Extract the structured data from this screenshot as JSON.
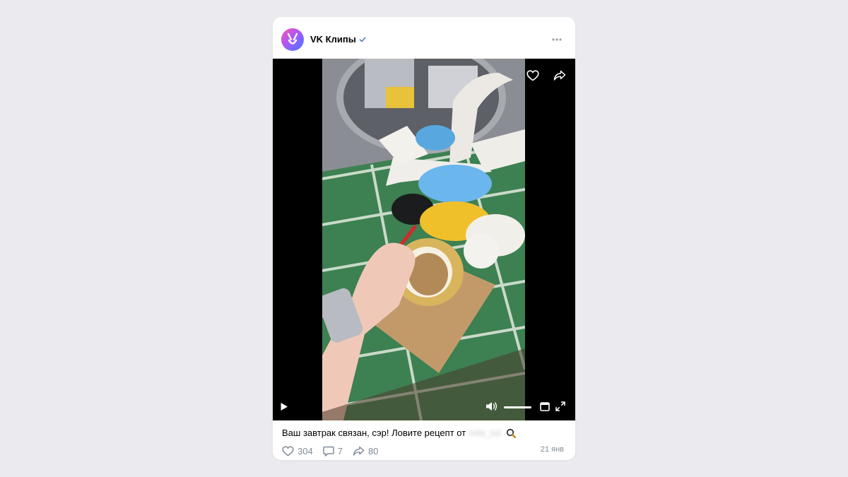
{
  "post": {
    "author": "VK Клипы",
    "caption": "Ваш завтрак связан, сэр! Ловите рецепт от",
    "caption_hidden_handle": "mila_tut",
    "likes": "304",
    "comments": "7",
    "shares": "80",
    "date": "21 янв"
  },
  "icons": {
    "avatar": "vk-clips-logo",
    "verified": "verified-check-icon",
    "more": "more-horizontal-icon",
    "like": "heart-icon",
    "share": "share-arrow-icon",
    "play": "play-icon",
    "volume": "speaker-icon",
    "miniplayer": "miniplayer-icon",
    "fullscreen": "fullscreen-icon",
    "comment": "comment-icon",
    "magnifier": "magnifier-emoji"
  },
  "colors": {
    "background": "#ebebef",
    "card": "#ffffff",
    "accent": "#2a5885",
    "muted": "#818c99",
    "verified": "#4a7bbf"
  }
}
